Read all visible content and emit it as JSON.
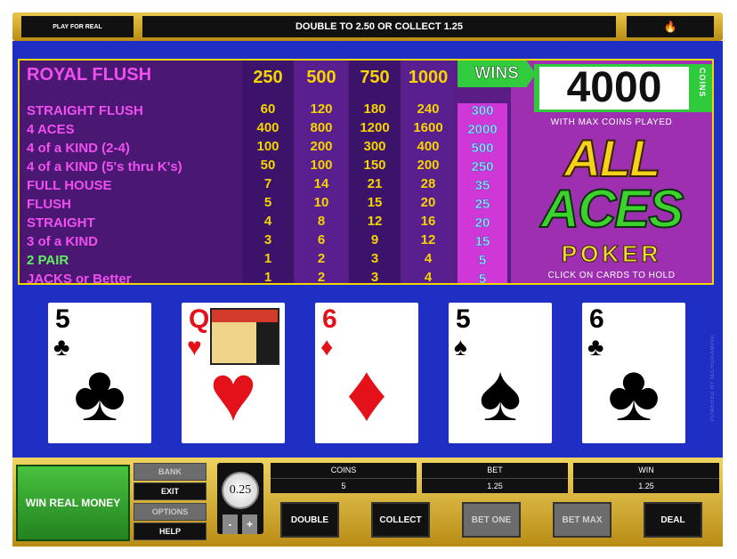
{
  "topbar": {
    "play_for_real": "PLAY FOR REAL",
    "message": "DOUBLE TO 2.50 OR COLLECT 1.25",
    "sound_icon": "flame-icon"
  },
  "paytable": {
    "hands": [
      {
        "name": "ROYAL FLUSH",
        "color": "#f04ff0",
        "payouts": [
          "250",
          "500",
          "750",
          "1000"
        ]
      },
      {
        "name": "STRAIGHT FLUSH",
        "color": "#f04ff0",
        "payouts": [
          "60",
          "120",
          "180",
          "240"
        ],
        "win": "300"
      },
      {
        "name": "4 ACES",
        "color": "#f04ff0",
        "payouts": [
          "400",
          "800",
          "1200",
          "1600"
        ],
        "win": "2000"
      },
      {
        "name": "4 of a KIND (2-4)",
        "color": "#f04ff0",
        "payouts": [
          "100",
          "200",
          "300",
          "400"
        ],
        "win": "500"
      },
      {
        "name": "4 of a KIND (5's thru K's)",
        "color": "#f04ff0",
        "payouts": [
          "50",
          "100",
          "150",
          "200"
        ],
        "win": "250"
      },
      {
        "name": "FULL HOUSE",
        "color": "#f04ff0",
        "payouts": [
          "7",
          "14",
          "21",
          "28"
        ],
        "win": "35"
      },
      {
        "name": "FLUSH",
        "color": "#f04ff0",
        "payouts": [
          "5",
          "10",
          "15",
          "20"
        ],
        "win": "25"
      },
      {
        "name": "STRAIGHT",
        "color": "#f04ff0",
        "payouts": [
          "4",
          "8",
          "12",
          "16"
        ],
        "win": "20"
      },
      {
        "name": "3 of a KIND",
        "color": "#f04ff0",
        "payouts": [
          "3",
          "6",
          "9",
          "12"
        ],
        "win": "15"
      },
      {
        "name": "2 PAIR",
        "color": "#5ef05e",
        "payouts": [
          "1",
          "2",
          "3",
          "4"
        ],
        "win": "5"
      },
      {
        "name": "JACKS or Better",
        "color": "#f04ff0",
        "payouts": [
          "1",
          "2",
          "3",
          "4"
        ],
        "win": "5"
      }
    ],
    "wins_label": "WINS",
    "wins_amount": "4000",
    "coins_label": "COINS",
    "max_coins_label": "WITH MAX COINS PLAYED",
    "logo_line1": "ALL",
    "logo_line2": "ACES",
    "logo_line3": "POKER",
    "hold_hint": "CLICK ON CARDS TO HOLD"
  },
  "cards": [
    {
      "rank": "5",
      "suit": "♣",
      "color": "black",
      "face": false
    },
    {
      "rank": "Q",
      "suit": "♥",
      "color": "red",
      "face": true
    },
    {
      "rank": "6",
      "suit": "♦",
      "color": "red",
      "face": false
    },
    {
      "rank": "5",
      "suit": "♠",
      "color": "black",
      "face": false
    },
    {
      "rank": "6",
      "suit": "♣",
      "color": "black",
      "face": false
    }
  ],
  "credit": "POWERED BY MICROGAMING",
  "bottom": {
    "win_real_money": "WIN REAL MONEY",
    "bank": "BANK",
    "exit": "EXIT",
    "options": "OPTIONS",
    "help": "HELP",
    "coin_value": "0.25",
    "minus": "-",
    "plus": "+",
    "coins_label": "COINS",
    "coins_value": "5",
    "bet_label": "BET",
    "bet_value": "1.25",
    "win_label": "WIN",
    "win_value": "1.25",
    "double": "DOUBLE",
    "collect": "COLLECT",
    "bet_one": "BET ONE",
    "bet_max": "BET MAX",
    "deal": "DEAL"
  }
}
